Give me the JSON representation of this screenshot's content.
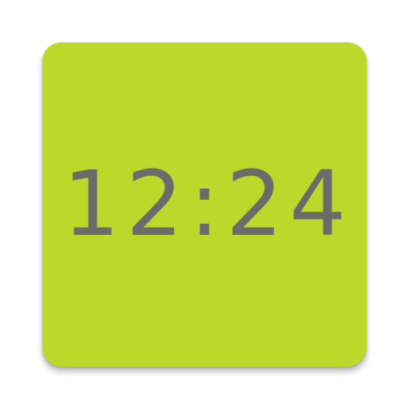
{
  "icon": {
    "time_text": "12:24"
  },
  "colors": {
    "tile_background": "#bcd92b",
    "time_text": "#6b6b6b",
    "page_background": "#ffffff"
  }
}
